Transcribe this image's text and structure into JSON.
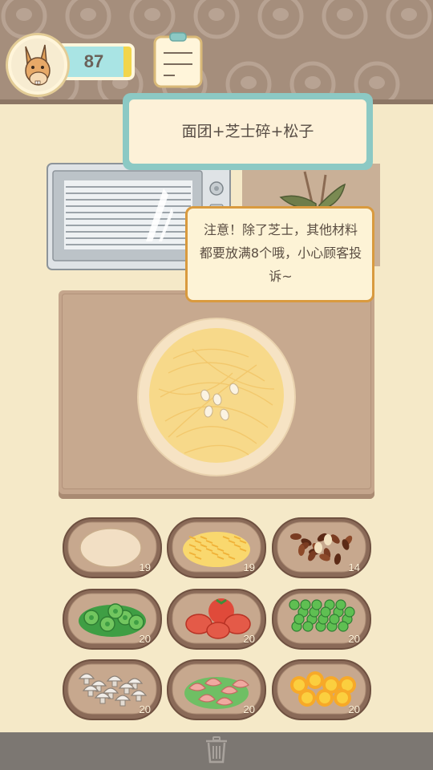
{
  "hud": {
    "avatar_icon": "donkey-avatar-icon",
    "score": "87",
    "notepad_icon": "notepad-icon"
  },
  "order": {
    "text": "面团+芝士碎+松子"
  },
  "tip": {
    "text": "注意！除了芝士，其他材料都要放满8个哦，小心顾客投诉~"
  },
  "ingredients": [
    {
      "id": "dough",
      "icon": "dough-icon",
      "count": "19"
    },
    {
      "id": "cheese",
      "icon": "shredded-cheese-icon",
      "count": "19"
    },
    {
      "id": "pine-nuts",
      "icon": "pine-nuts-icon",
      "count": "14"
    },
    {
      "id": "green-pepper",
      "icon": "green-pepper-icon",
      "count": "20"
    },
    {
      "id": "tomato",
      "icon": "tomato-icon",
      "count": "20"
    },
    {
      "id": "peas",
      "icon": "peas-icon",
      "count": "20"
    },
    {
      "id": "mushroom",
      "icon": "mushroom-icon",
      "count": "20"
    },
    {
      "id": "shrimp",
      "icon": "shrimp-icon",
      "count": "20"
    },
    {
      "id": "corn",
      "icon": "corn-icon",
      "count": "20"
    }
  ],
  "footer": {
    "trash_icon": "trash-icon"
  },
  "colors": {
    "background": "#f5e9c8",
    "topbar": "#a58e7c",
    "order_border": "#8cc9c4",
    "tip_border": "#d99a3e",
    "board": "#c4a58c",
    "tray": "#8a6a58",
    "bottombar": "#7c7772"
  }
}
